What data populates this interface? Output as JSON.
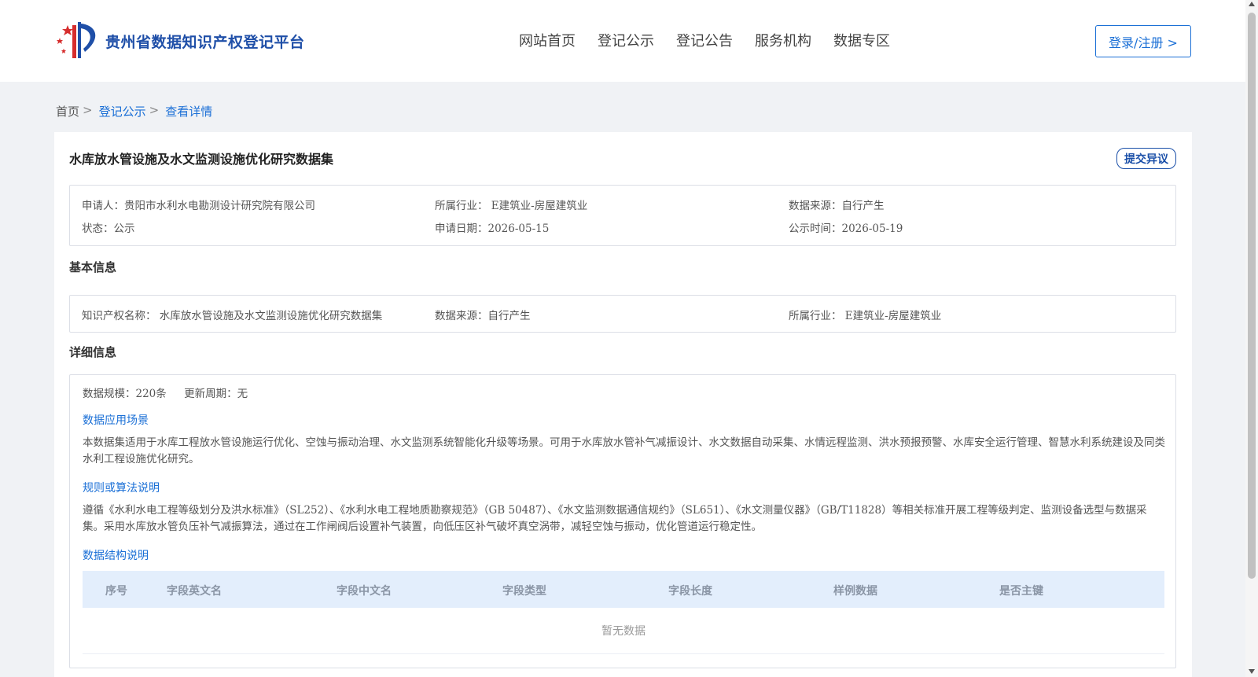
{
  "header": {
    "logo_text": "贵州省数据知识产权登记平台",
    "nav": [
      "网站首页",
      "登记公示",
      "登记公告",
      "服务机构",
      "数据专区"
    ],
    "login_label": "登录/注册 >"
  },
  "breadcrumb": {
    "home": "首页",
    "sep": ">",
    "items": [
      "登记公示",
      "查看详情"
    ]
  },
  "detail": {
    "title": "水库放水管设施及水文监测设施优化研究数据集",
    "objection_label": "提交异议",
    "summary": {
      "applicant": "申请人：贵阳市水利水电勘测设计研究院有限公司",
      "industry": "所属行业： E建筑业-房屋建筑业",
      "source": "数据来源：自行产生",
      "status": "状态：公示",
      "apply_date": "申请日期：2026-05-15",
      "publish_date": "公示时间：2026-05-19"
    },
    "basic": {
      "title": "基本信息",
      "name": "知识产权名称： 水库放水管设施及水文监测设施优化研究数据集",
      "source": "数据来源：自行产生",
      "industry": "所属行业： E建筑业-房屋建筑业"
    },
    "info": {
      "title": "详细信息",
      "scale": "数据规模：220条",
      "cycle": "更新周期：无",
      "scene_title": "数据应用场景",
      "scene_text": "本数据集适用于水库工程放水管设施运行优化、空蚀与振动治理、水文监测系统智能化升级等场景。可用于水库放水管补气减振设计、水文数据自动采集、水情远程监测、洪水预报预警、水库安全运行管理、智慧水利系统建设及同类水利工程设施优化研究。",
      "rule_title": "规则或算法说明",
      "rule_text": "遵循《水利水电工程等级划分及洪水标准》（SL252）、《水利水电工程地质勘察规范》（GB 50487）、《水文监测数据通信规约》（SL651）、《水文测量仪器》（GB/T11828）等相关标准开展工程等级判定、监测设备选型与数据采集。采用水库放水管负压补气减振算法，通过在工作闸阀后设置补气装置，向低压区补气破坏真空涡带，减轻空蚀与振动，优化管道运行稳定性。",
      "structure_title": "数据结构说明",
      "table_headers": [
        "序号",
        "字段英文名",
        "字段中文名",
        "字段类型",
        "字段长度",
        "样例数据",
        "是否主键"
      ],
      "empty_text": "暂无数据"
    }
  }
}
